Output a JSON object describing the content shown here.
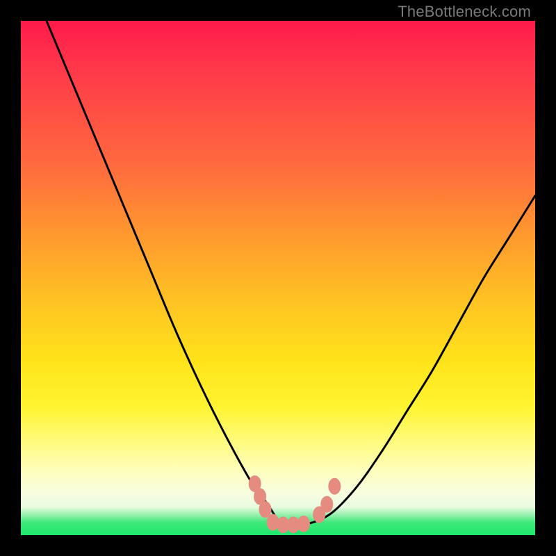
{
  "watermark": "TheBottleneck.com",
  "chart_data": {
    "type": "line",
    "title": "",
    "xlabel": "",
    "ylabel": "",
    "xlim": [
      0,
      100
    ],
    "ylim": [
      0,
      100
    ],
    "series": [
      {
        "name": "bottleneck-curve",
        "x": [
          5,
          10,
          15,
          20,
          25,
          30,
          35,
          40,
          45,
          48,
          50,
          52,
          55,
          60,
          65,
          70,
          75,
          80,
          85,
          90,
          95,
          100
        ],
        "values": [
          100,
          88,
          76,
          64,
          52,
          40,
          29,
          19,
          10,
          6,
          3,
          2,
          2,
          4,
          9,
          16,
          24,
          32,
          41,
          50,
          58,
          66
        ]
      }
    ],
    "markers": [
      {
        "name": "left-shoulder-marker-1",
        "x": 45.5,
        "y_pct": 10
      },
      {
        "name": "left-shoulder-marker-2",
        "x": 46.5,
        "y_pct": 7.5
      },
      {
        "name": "left-shoulder-marker-3",
        "x": 47.5,
        "y_pct": 5
      },
      {
        "name": "valley-marker-1",
        "x": 49,
        "y_pct": 2.5
      },
      {
        "name": "valley-marker-2",
        "x": 51,
        "y_pct": 2
      },
      {
        "name": "valley-marker-3",
        "x": 53,
        "y_pct": 2
      },
      {
        "name": "valley-marker-4",
        "x": 55,
        "y_pct": 2.2
      },
      {
        "name": "right-shoulder-marker-1",
        "x": 58,
        "y_pct": 4
      },
      {
        "name": "right-shoulder-marker-2",
        "x": 59.5,
        "y_pct": 6
      },
      {
        "name": "right-shoulder-marker-3",
        "x": 61,
        "y_pct": 9.5
      }
    ],
    "gradient_stops": [
      {
        "pct": 0,
        "color": "#ff1a4a"
      },
      {
        "pct": 28,
        "color": "#ff6a3e"
      },
      {
        "pct": 55,
        "color": "#ffc423"
      },
      {
        "pct": 75,
        "color": "#fff430"
      },
      {
        "pct": 92,
        "color": "#f8fde0"
      },
      {
        "pct": 100,
        "color": "#1de76c"
      }
    ]
  }
}
